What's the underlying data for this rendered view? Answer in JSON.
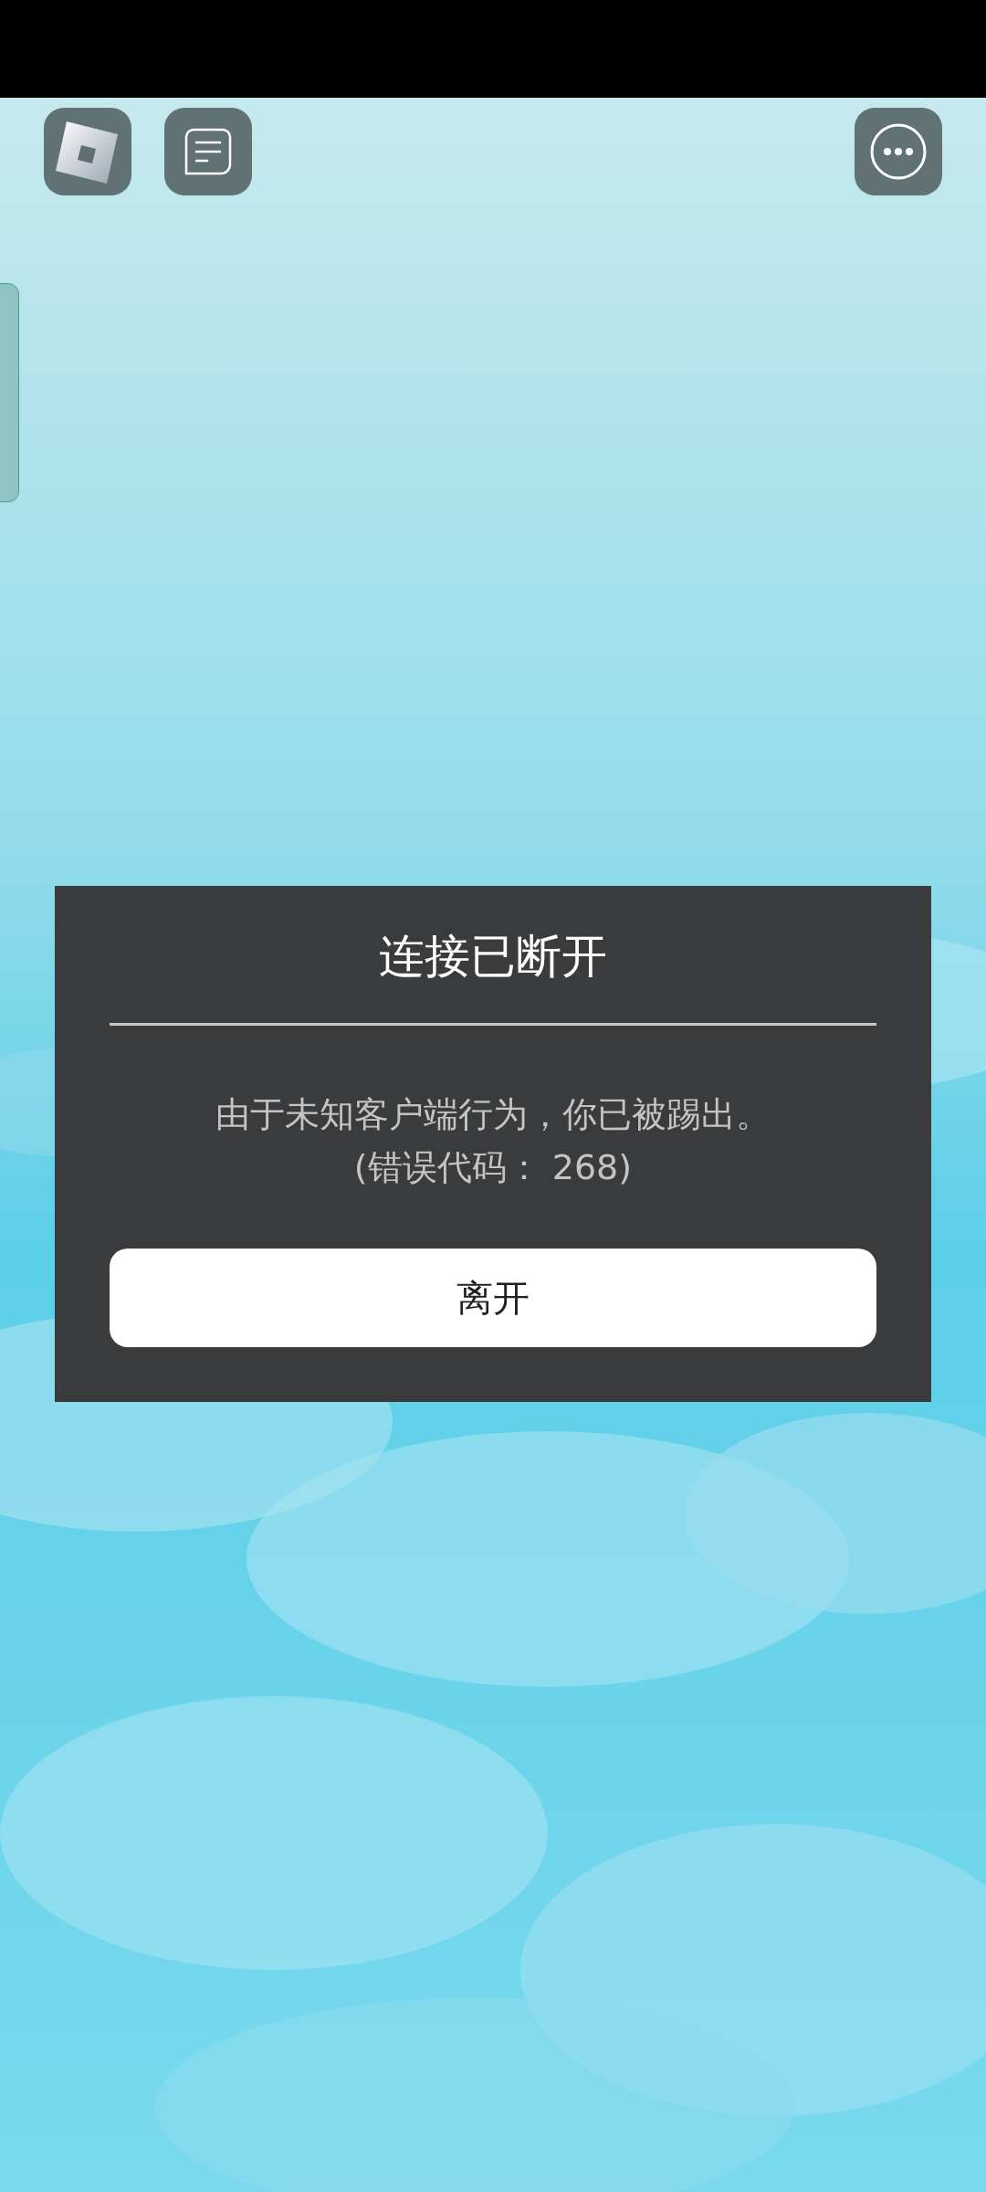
{
  "dialog": {
    "title": "连接已断开",
    "message_lines": [
      "由于未知客户端行为，你已被踢出。",
      "(错误代码： 268)"
    ],
    "button": "离开"
  }
}
